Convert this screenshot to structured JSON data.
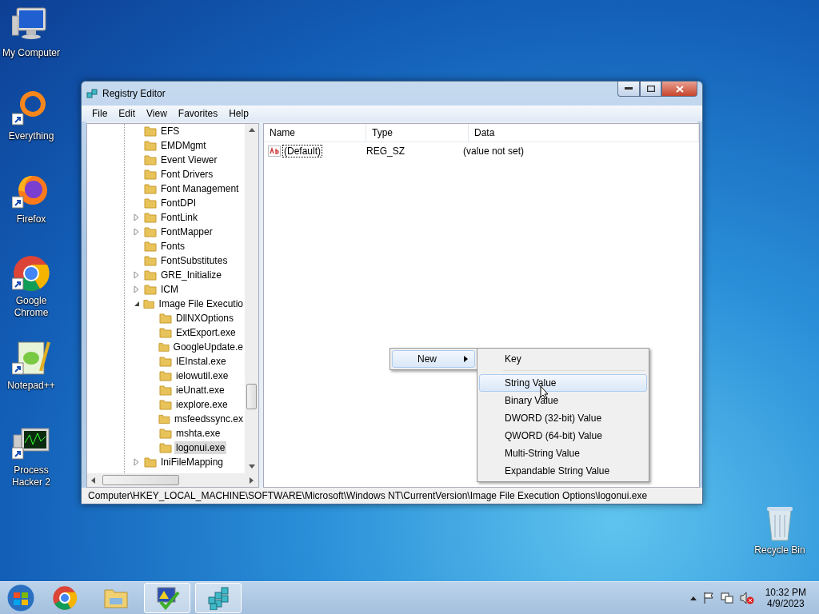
{
  "desktop_icons": [
    {
      "label": "My Computer",
      "kind": "computer",
      "shortcut": false
    },
    {
      "label": "Everything",
      "kind": "ring",
      "shortcut": true
    },
    {
      "label": "Firefox",
      "kind": "fox",
      "shortcut": true
    },
    {
      "label": "Google Chrome",
      "kind": "chrome",
      "shortcut": true
    },
    {
      "label": "Notepad++",
      "kind": "notepad",
      "shortcut": true
    },
    {
      "label": "Process Hacker 2",
      "kind": "monitor",
      "shortcut": true
    },
    {
      "label": "Recycle Bin",
      "kind": "bin",
      "shortcut": false
    }
  ],
  "window": {
    "title": "Registry Editor",
    "menu": [
      "File",
      "Edit",
      "View",
      "Favorites",
      "Help"
    ],
    "tree": [
      {
        "label": "EFS",
        "expandable": false,
        "selected": false
      },
      {
        "label": "EMDMgmt",
        "expandable": false,
        "selected": false
      },
      {
        "label": "Event Viewer",
        "expandable": false,
        "selected": false
      },
      {
        "label": "Font Drivers",
        "expandable": false,
        "selected": false
      },
      {
        "label": "Font Management",
        "expandable": false,
        "selected": false
      },
      {
        "label": "FontDPI",
        "expandable": false,
        "selected": false
      },
      {
        "label": "FontLink",
        "expandable": true,
        "expanded": false,
        "selected": false
      },
      {
        "label": "FontMapper",
        "expandable": true,
        "expanded": false,
        "selected": false
      },
      {
        "label": "Fonts",
        "expandable": false,
        "selected": false
      },
      {
        "label": "FontSubstitutes",
        "expandable": false,
        "selected": false
      },
      {
        "label": "GRE_Initialize",
        "expandable": true,
        "expanded": false,
        "selected": false
      },
      {
        "label": "ICM",
        "expandable": true,
        "expanded": false,
        "selected": false
      },
      {
        "label": "Image File Executio",
        "expandable": true,
        "expanded": true,
        "selected": false,
        "children": [
          {
            "label": "DllNXOptions",
            "expandable": false,
            "selected": false
          },
          {
            "label": "ExtExport.exe",
            "expandable": false,
            "selected": false
          },
          {
            "label": "GoogleUpdate.e",
            "expandable": false,
            "selected": false
          },
          {
            "label": "IEInstal.exe",
            "expandable": false,
            "selected": false
          },
          {
            "label": "ielowutil.exe",
            "expandable": false,
            "selected": false
          },
          {
            "label": "ieUnatt.exe",
            "expandable": false,
            "selected": false
          },
          {
            "label": "iexplore.exe",
            "expandable": false,
            "selected": false
          },
          {
            "label": "msfeedssync.ex",
            "expandable": false,
            "selected": false
          },
          {
            "label": "mshta.exe",
            "expandable": false,
            "selected": false
          },
          {
            "label": "logonui.exe",
            "expandable": false,
            "selected": true
          }
        ]
      },
      {
        "label": "IniFileMapping",
        "expandable": true,
        "expanded": false,
        "selected": false
      }
    ],
    "columns": [
      "Name",
      "Type",
      "Data"
    ],
    "rows": [
      {
        "name": "(Default)",
        "type": "REG_SZ",
        "data": "(value not set)",
        "focused": true
      }
    ],
    "status_bar": "Computer\\HKEY_LOCAL_MACHINE\\SOFTWARE\\Microsoft\\Windows NT\\CurrentVersion\\Image File Execution Options\\logonui.exe"
  },
  "context_menu": {
    "label": "New",
    "submenu": [
      {
        "label": "Key",
        "selected": false
      },
      {
        "label": "String Value",
        "selected": true
      },
      {
        "label": "Binary Value",
        "selected": false
      },
      {
        "label": "DWORD (32-bit) Value",
        "selected": false
      },
      {
        "label": "QWORD (64-bit) Value",
        "selected": false
      },
      {
        "label": "Multi-String Value",
        "selected": false
      },
      {
        "label": "Expandable String Value",
        "selected": false
      }
    ]
  },
  "taskbar": {
    "apps": [
      {
        "kind": "chrome",
        "running": false
      },
      {
        "kind": "explorer",
        "running": false
      },
      {
        "kind": "checkmark",
        "running": true
      },
      {
        "kind": "registry",
        "running": true
      }
    ],
    "time": "10:32 PM",
    "date": "4/9/2023"
  }
}
